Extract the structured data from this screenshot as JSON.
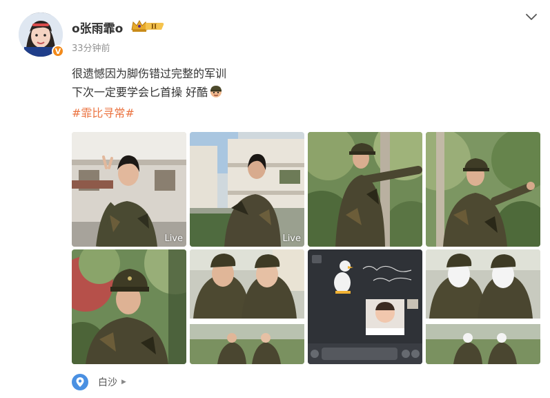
{
  "post": {
    "username": "o张雨霏o",
    "vip_level": "II",
    "verified_mark": "V",
    "time": "33分钟前",
    "text_lines": [
      "很遗憾因为脚伤错过完整的军训",
      "下次一定要学会匕首操 好酷"
    ],
    "hashtag": "#霏比寻常#",
    "location": "白沙"
  },
  "images": [
    {
      "name": "photo-1",
      "live": "Live"
    },
    {
      "name": "photo-2",
      "live": "Live"
    },
    {
      "name": "photo-3"
    },
    {
      "name": "photo-4"
    },
    {
      "name": "photo-5"
    },
    {
      "name": "photo-6"
    },
    {
      "name": "photo-7"
    },
    {
      "name": "photo-8"
    }
  ],
  "colors": {
    "hashtag": "#eb7340",
    "timestamp": "#939393",
    "location_icon": "#4a90e2",
    "verified_badge": "#f28a1b"
  },
  "icons": {
    "menu": "chevron-down-icon",
    "vip": "crown-icon",
    "location": "map-pin-icon",
    "emoji": "soldier-face-emoji"
  }
}
